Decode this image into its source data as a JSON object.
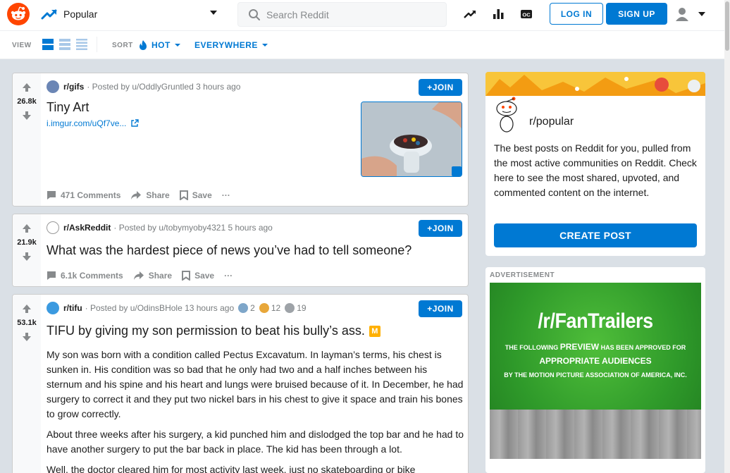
{
  "header": {
    "feed_label": "Popular",
    "search_placeholder": "Search Reddit",
    "login_label": "LOG IN",
    "signup_label": "SIGN UP",
    "icons": [
      "reddit-logo",
      "trending-icon",
      "stats-icon",
      "oc-icon",
      "user-icon"
    ]
  },
  "sortbar": {
    "view_label": "VIEW",
    "sort_label": "SORT",
    "hot_label": "HOT",
    "everywhere_label": "EVERYWHERE"
  },
  "posts": [
    {
      "votes": "26.8k",
      "subreddit": "r/gifs",
      "posted_by": "· Posted by u/OddlyGruntled 3 hours ago",
      "join_label": "+JOIN",
      "title": "Tiny Art",
      "link": "i.imgur.com/uQf7ve...",
      "comments": "471 Comments",
      "share": "Share",
      "save": "Save",
      "more": "···"
    },
    {
      "votes": "21.9k",
      "subreddit": "r/AskReddit",
      "posted_by": "· Posted by u/tobymyoby4321 5 hours ago",
      "join_label": "+JOIN",
      "title": "What was the hardest piece of news you’ve had to tell someone?",
      "comments": "6.1k Comments",
      "share": "Share",
      "save": "Save",
      "more": "···"
    },
    {
      "votes": "53.1k",
      "subreddit": "r/tifu",
      "posted_by": "· Posted by u/OdinsBHole 13 hours ago",
      "awards": [
        "2",
        "12",
        "19"
      ],
      "join_label": "+JOIN",
      "title": "TIFU by giving my son permission to beat his bully’s ass.",
      "flair": "M",
      "paragraphs": [
        "My son was born with a condition called Pectus Excavatum. In layman’s terms, his chest is sunken in. His condition was so bad that he only had two and a half inches between his sternum and his spine and his heart and lungs were bruised because of it. In December, he had surgery to correct it and they put two nickel bars in his chest to give it space and train his bones to grow correctly.",
        "About three weeks after his surgery, a kid punched him and dislodged the top bar and he had to have another surgery to put the bar back in place. The kid has been through a lot.",
        "Well, the doctor cleared him for most activity last week, just no skateboarding or bike"
      ]
    }
  ],
  "sidebar": {
    "name": "r/popular",
    "description": "The best posts on Reddit for you, pulled from the most active communities on Reddit. Check here to see the most shared, upvoted, and commented content on the internet.",
    "create_post": "CREATE POST"
  },
  "ad": {
    "label": "ADVERTISEMENT",
    "title": "/r/FanTrailers",
    "line1_pre": "THE FOLLOWING",
    "line1_bold": "PREVIEW",
    "line1_post": "HAS BEEN APPROVED FOR",
    "line2": "APPROPRIATE AUDIENCES",
    "line3": "BY THE MOTION PICTURE ASSOCIATION OF AMERICA, INC."
  },
  "colors": {
    "brand": "#ff4500",
    "accent": "#0079d3",
    "background": "#dae0e6"
  }
}
